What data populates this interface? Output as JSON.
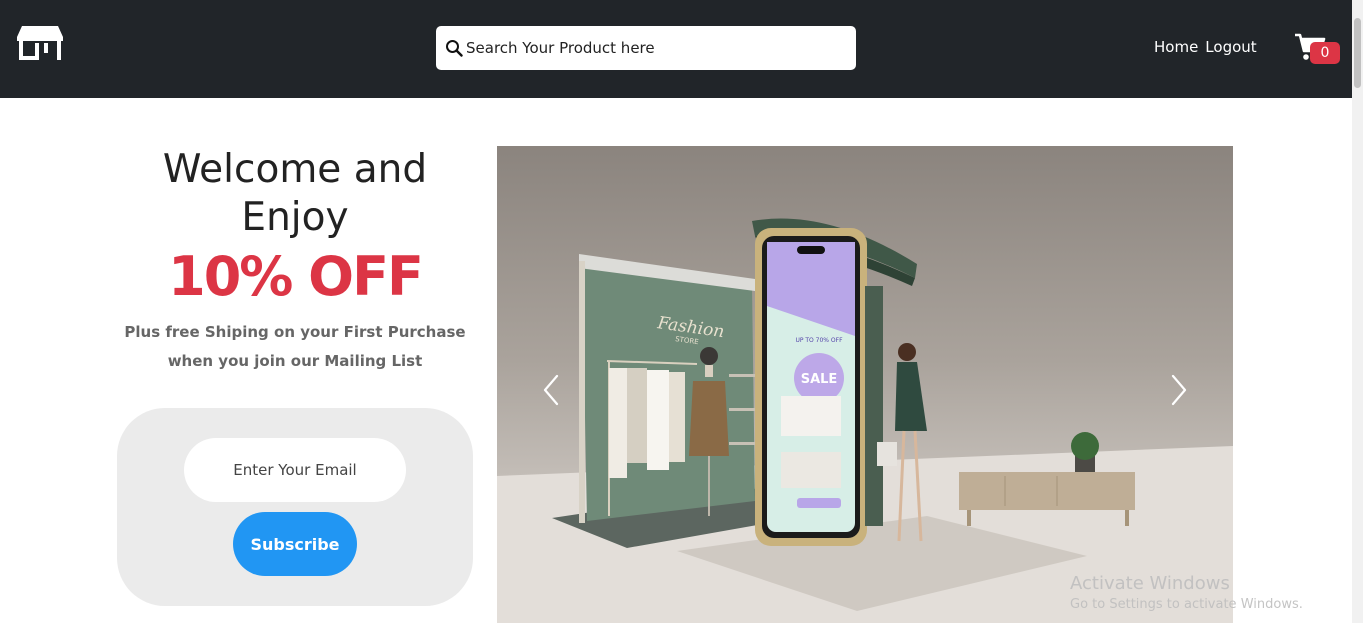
{
  "header": {
    "logo_icon": "storefront-icon",
    "search": {
      "placeholder": "Search Your Product here",
      "icon": "search-icon"
    },
    "nav": {
      "home_label": "Home",
      "logout_label": "Logout"
    },
    "cart": {
      "icon": "cart-icon",
      "count": "0"
    }
  },
  "promo": {
    "welcome_line1": "Welcome and",
    "welcome_line2": "Enjoy",
    "offer": "10% OFF",
    "desc_line1": "Plus free Shiping on your First Purchase",
    "desc_line2": "when you join our Mailing List",
    "email_placeholder": "Enter Your Email",
    "subscribe_label": "Subscribe"
  },
  "carousel": {
    "prev_icon": "chevron-left-icon",
    "next_icon": "chevron-right-icon",
    "slide_text": {
      "store_sign_line1": "Fashion",
      "store_sign_line2": "STORE",
      "phone_sale": "SALE",
      "phone_promo": "UP TO 70% OFF"
    }
  },
  "watermark": {
    "title": "Activate Windows",
    "subtitle": "Go to Settings to activate Windows."
  },
  "colors": {
    "header_bg": "#212529",
    "offer_red": "#dc3545",
    "subscribe_blue": "#2196f3",
    "card_gray": "#ebebeb"
  }
}
